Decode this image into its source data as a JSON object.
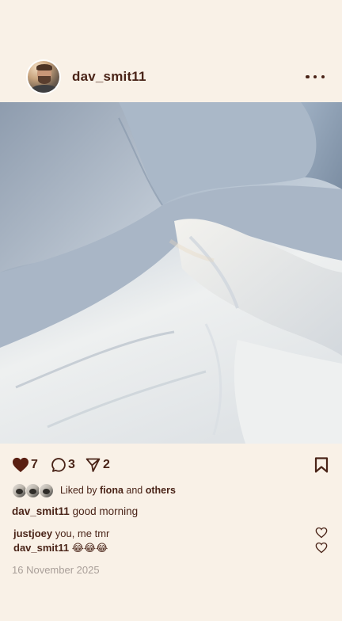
{
  "post": {
    "username": "dav_smit11",
    "likes": "7",
    "comments": "3",
    "shares": "2",
    "liked_by": {
      "prefix": "Liked by",
      "name": "fiona",
      "and": "and",
      "others": "others"
    },
    "caption": {
      "username": "dav_smit11",
      "text": "good morning"
    },
    "comment_list": [
      {
        "username": "justjoey",
        "text": "you, me tmr"
      },
      {
        "username": "dav_smit11",
        "text": "😂😂😂"
      }
    ],
    "date": "16 November 2025"
  },
  "colors": {
    "background": "#f9f1e7",
    "text": "#4a2418",
    "muted": "#a99f99"
  },
  "icons": {
    "more": "more-horizontal-icon",
    "like": "heart-filled-icon",
    "comment": "comment-bubble-icon",
    "share": "send-icon",
    "save": "bookmark-icon",
    "comment_like": "heart-outline-icon"
  }
}
